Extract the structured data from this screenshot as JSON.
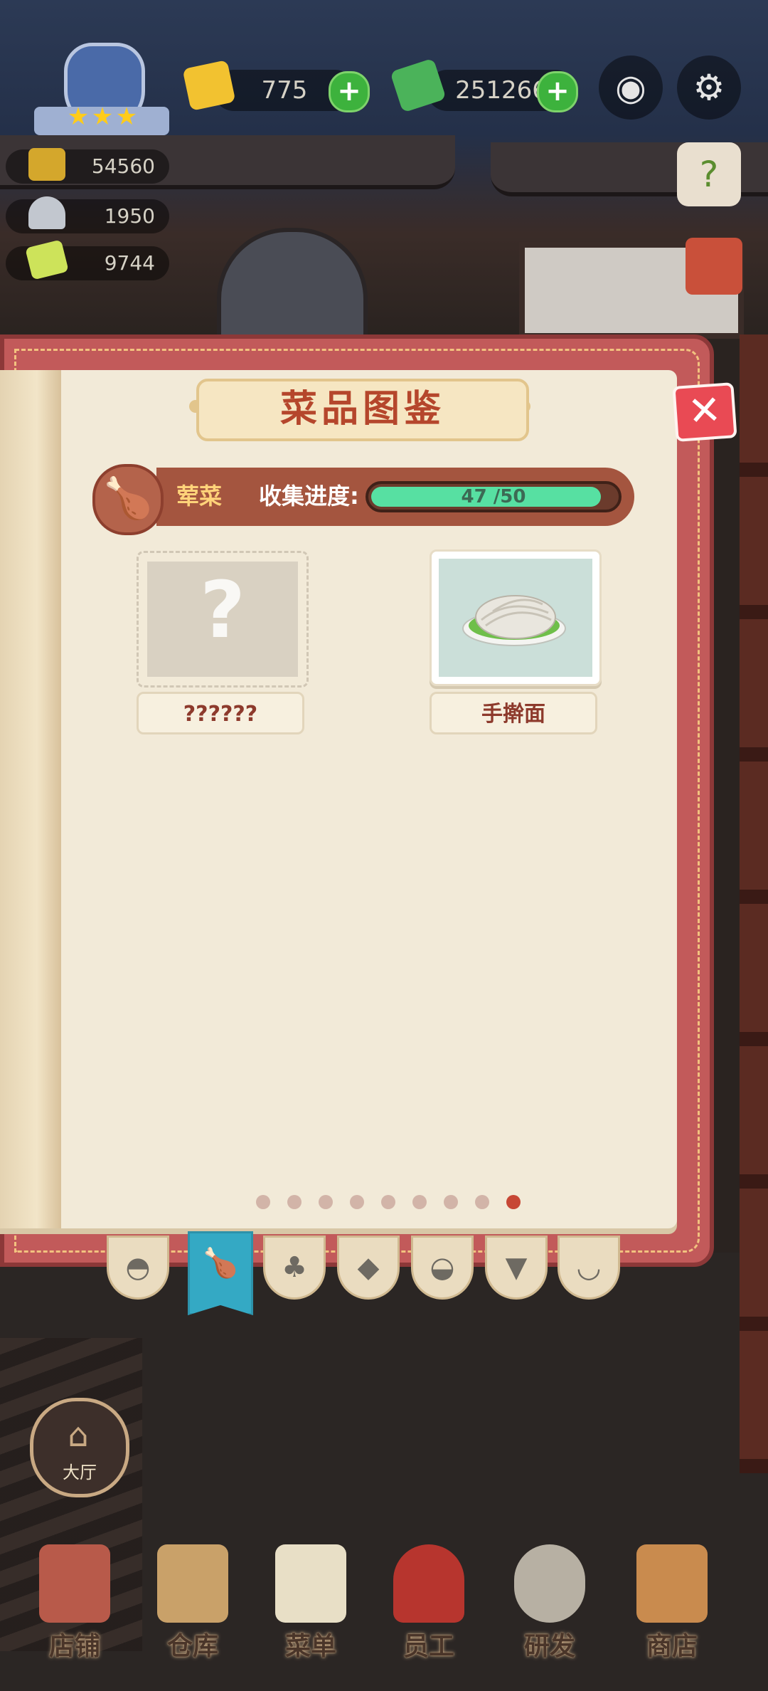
{
  "hud": {
    "gems": "775",
    "cash": "251266",
    "stat_gold": "54560",
    "stat_dish": "1950",
    "stat_ticket": "9744"
  },
  "book": {
    "title": "菜品图鉴",
    "close_symbol": "✕",
    "category_name": "荤菜",
    "progress_label": "收集进度:",
    "progress_text": "47 /50",
    "progress_value": 0.94,
    "dishes": [
      {
        "name": "??????",
        "locked": true,
        "placeholder": "?"
      },
      {
        "name": "手擀面",
        "locked": false
      }
    ],
    "page_dots": 9,
    "active_page": 9
  },
  "tabs": [
    {
      "icon": "wok-icon"
    },
    {
      "icon": "drumstick-icon",
      "active": true
    },
    {
      "icon": "broccoli-icon"
    },
    {
      "icon": "fish-icon"
    },
    {
      "icon": "bread-icon"
    },
    {
      "icon": "wine-glass-icon"
    },
    {
      "icon": "soup-icon"
    }
  ],
  "hall": {
    "label": "大厅"
  },
  "nav": [
    {
      "label": "店铺",
      "icon": "shop-icon"
    },
    {
      "label": "仓库",
      "icon": "warehouse-icon"
    },
    {
      "label": "菜单",
      "icon": "menu-icon"
    },
    {
      "label": "员工",
      "icon": "staff-icon"
    },
    {
      "label": "研发",
      "icon": "research-icon"
    },
    {
      "label": "商店",
      "icon": "store-icon"
    }
  ],
  "colors": {
    "accent_red": "#c25a5a",
    "progress_green": "#57e0a2",
    "active_tab": "#34a9c4"
  }
}
